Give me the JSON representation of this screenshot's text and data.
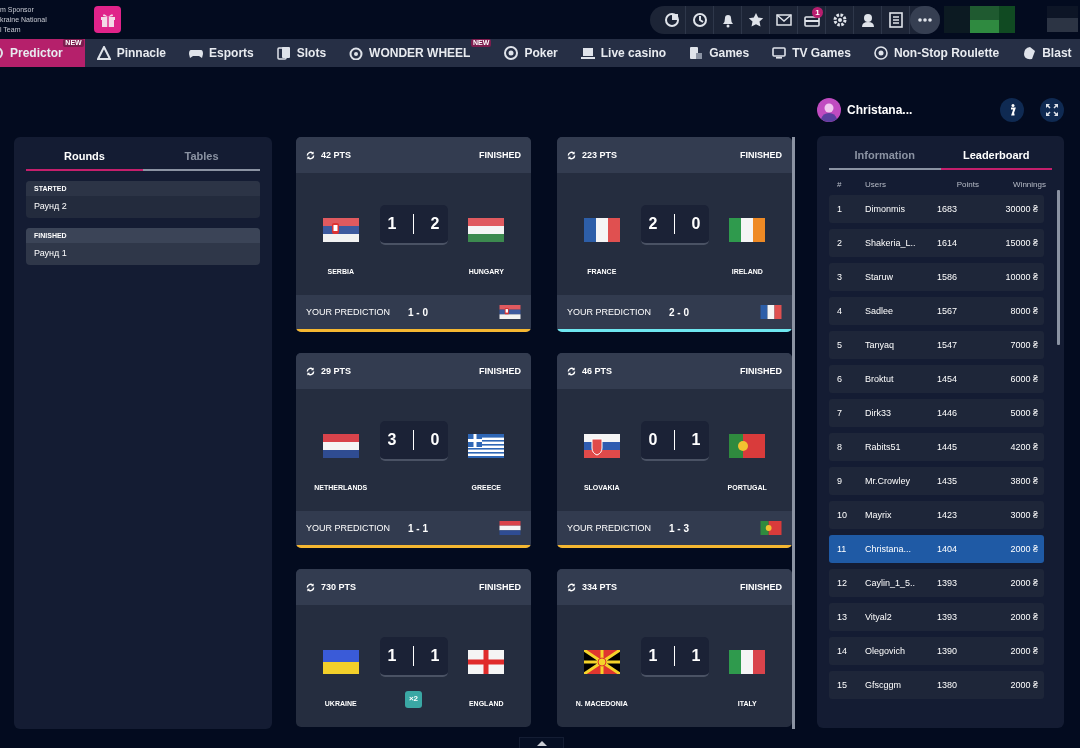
{
  "sponsor": {
    "lines": [
      "m Sponsor",
      "kraine National",
      "l Team"
    ]
  },
  "toolbar": {
    "badge": "1"
  },
  "nav": [
    {
      "label": "Predictor",
      "selected": true,
      "badge": "NEW",
      "kind": "predictor"
    },
    {
      "label": "Pinnacle",
      "selected": false,
      "kind": "pinnacle"
    },
    {
      "label": "Esports",
      "selected": false,
      "kind": "esports"
    },
    {
      "label": "Slots",
      "selected": false,
      "kind": "slots"
    },
    {
      "label": "WONDER WHEEL",
      "selected": false,
      "badge": "NEW",
      "kind": "wheel"
    },
    {
      "label": "Poker",
      "selected": false,
      "kind": "poker"
    },
    {
      "label": "Live casino",
      "selected": false,
      "kind": "live"
    },
    {
      "label": "Games",
      "selected": false,
      "kind": "games"
    },
    {
      "label": "TV Games",
      "selected": false,
      "kind": "tv"
    },
    {
      "label": "Non-Stop Roulette",
      "selected": false,
      "kind": "roulette"
    },
    {
      "label": "Blast",
      "selected": false,
      "kind": "blast"
    }
  ],
  "left_panel": {
    "tabs": [
      {
        "label": "Rounds",
        "selected": true
      },
      {
        "label": "Tables",
        "selected": false
      }
    ],
    "rounds": [
      {
        "status": "STARTED",
        "name": "Раунд 2",
        "selected": false
      },
      {
        "status": "FINISHED",
        "name": "Раунд 1",
        "selected": true
      }
    ]
  },
  "matches": [
    {
      "points": "42 PTS",
      "status": "FINISHED",
      "home": {
        "name": "SERBIA",
        "kind": "rs"
      },
      "away": {
        "name": "HUNGARY",
        "kind": "hu"
      },
      "score": [
        "1",
        "2"
      ],
      "prediction": {
        "label": "YOUR PREDICTION",
        "score": "1 - 0",
        "kind": "rs"
      },
      "color": "#f5b731"
    },
    {
      "points": "223 PTS",
      "status": "FINISHED",
      "home": {
        "name": "FRANCE",
        "kind": "fr"
      },
      "away": {
        "name": "IRELAND",
        "kind": "ie"
      },
      "score": [
        "2",
        "0"
      ],
      "prediction": {
        "label": "YOUR PREDICTION",
        "score": "2 - 0",
        "kind": "fr"
      },
      "color": "#6ee7f0"
    },
    {
      "points": "29 PTS",
      "status": "FINISHED",
      "home": {
        "name": "NETHERLANDS",
        "kind": "nl"
      },
      "away": {
        "name": "GREECE",
        "kind": "gr"
      },
      "score": [
        "3",
        "0"
      ],
      "prediction": {
        "label": "YOUR PREDICTION",
        "score": "1 - 1",
        "kind": "nl"
      },
      "color": "#f5b731"
    },
    {
      "points": "46 PTS",
      "status": "FINISHED",
      "home": {
        "name": "SLOVAKIA",
        "kind": "sk"
      },
      "away": {
        "name": "PORTUGAL",
        "kind": "pt"
      },
      "score": [
        "0",
        "1"
      ],
      "prediction": {
        "label": "YOUR PREDICTION",
        "score": "1 - 3",
        "kind": "pt"
      },
      "color": "#f5b731"
    },
    {
      "points": "730 PTS",
      "status": "FINISHED",
      "home": {
        "name": "UKRAINE",
        "kind": "ua"
      },
      "away": {
        "name": "ENGLAND",
        "kind": "en"
      },
      "score": [
        "1",
        "1"
      ],
      "multiplier": "×2"
    },
    {
      "points": "334 PTS",
      "status": "FINISHED",
      "home": {
        "name": "N. MACEDONIA",
        "kind": "mk"
      },
      "away": {
        "name": "ITALY",
        "kind": "it"
      },
      "score": [
        "1",
        "1"
      ]
    }
  ],
  "user": {
    "name": "Christana..."
  },
  "right_panel": {
    "tabs": [
      {
        "label": "Information",
        "selected": false
      },
      {
        "label": "Leaderboard",
        "selected": true
      }
    ],
    "columns": [
      "#",
      "Users",
      "Points",
      "Winnings"
    ],
    "rows": [
      {
        "rank": "1",
        "user": "Dimonmis",
        "points": "1683",
        "winnings": "30000 ₴",
        "selected": false
      },
      {
        "rank": "2",
        "user": "Shakeria_L..",
        "points": "1614",
        "winnings": "15000 ₴",
        "selected": false
      },
      {
        "rank": "3",
        "user": "Staruw",
        "points": "1586",
        "winnings": "10000 ₴",
        "selected": false
      },
      {
        "rank": "4",
        "user": "Sadlee",
        "points": "1567",
        "winnings": "8000 ₴",
        "selected": false
      },
      {
        "rank": "5",
        "user": "Tanyaq",
        "points": "1547",
        "winnings": "7000 ₴",
        "selected": false
      },
      {
        "rank": "6",
        "user": "Broktut",
        "points": "1454",
        "winnings": "6000 ₴",
        "selected": false
      },
      {
        "rank": "7",
        "user": "Dirk33",
        "points": "1446",
        "winnings": "5000 ₴",
        "selected": false
      },
      {
        "rank": "8",
        "user": "Rabits51",
        "points": "1445",
        "winnings": "4200 ₴",
        "selected": false
      },
      {
        "rank": "9",
        "user": "Mr.Crowley",
        "points": "1435",
        "winnings": "3800 ₴",
        "selected": false
      },
      {
        "rank": "10",
        "user": "Mayrix",
        "points": "1423",
        "winnings": "3000 ₴",
        "selected": false
      },
      {
        "rank": "11",
        "user": "Christana...",
        "points": "1404",
        "winnings": "2000 ₴",
        "selected": true
      },
      {
        "rank": "12",
        "user": "Caylin_1_5..",
        "points": "1393",
        "winnings": "2000 ₴",
        "selected": false
      },
      {
        "rank": "13",
        "user": "Vityal2",
        "points": "1393",
        "winnings": "2000 ₴",
        "selected": false
      },
      {
        "rank": "14",
        "user": "Olegovich",
        "points": "1390",
        "winnings": "2000 ₴",
        "selected": false
      },
      {
        "rank": "15",
        "user": "Gfscggm",
        "points": "1380",
        "winnings": "2000 ₴",
        "selected": false
      }
    ]
  }
}
